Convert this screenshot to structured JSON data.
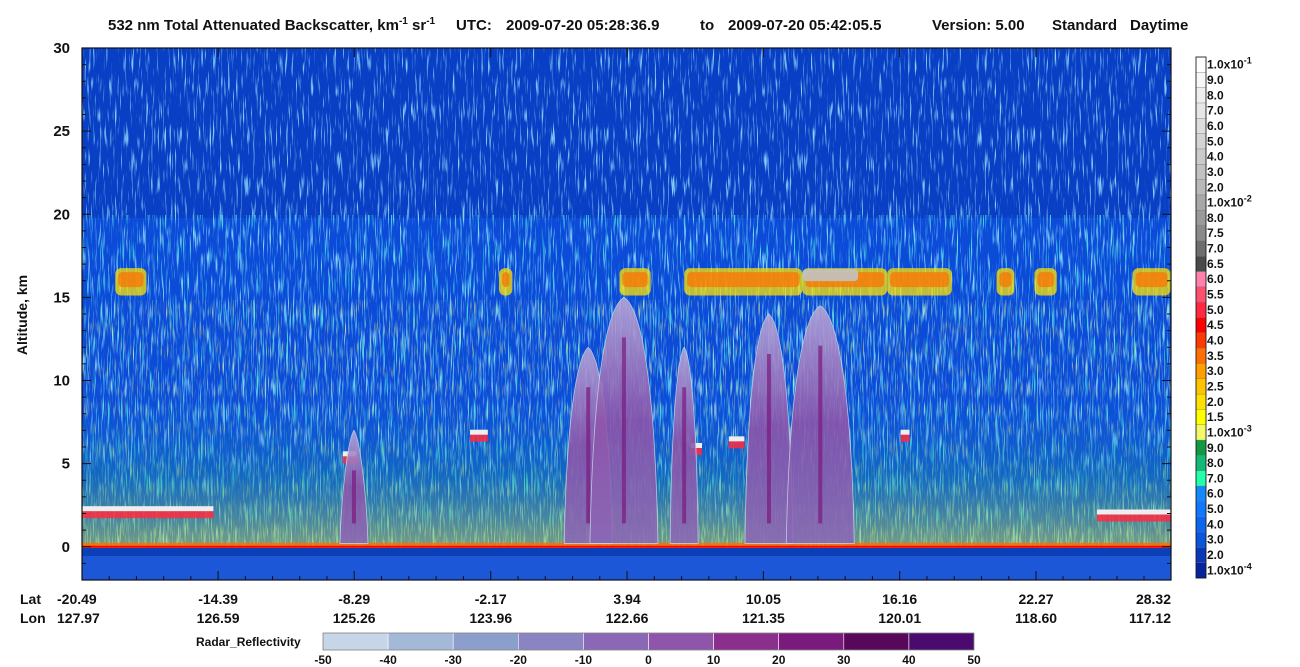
{
  "chart_data": {
    "type": "heatmap",
    "title": "532 nm Total Attenuated Backscatter, km",
    "title_unit_sup1": "-1",
    "title_unit_mid": " sr",
    "title_unit_sup2": "-1",
    "utc_label": "UTC:",
    "utc_start": "2009-07-20 05:28:36.9",
    "utc_to": "to",
    "utc_end": "2009-07-20 05:42:05.5",
    "version_label": "Version: 5.00",
    "product": "Standard",
    "mode": "Daytime",
    "ylabel": "Altitude, km",
    "ylim": [
      -2,
      30
    ],
    "yticks": [
      "0",
      "5",
      "10",
      "15",
      "20",
      "25",
      "30"
    ],
    "lat_label": "Lat",
    "lon_label": "Lon",
    "lat_ticks": [
      "-20.49",
      "-14.39",
      "-8.29",
      "-2.17",
      "3.94",
      "10.05",
      "16.16",
      "22.27",
      "28.32"
    ],
    "lon_ticks": [
      "127.97",
      "126.59",
      "125.26",
      "123.96",
      "122.66",
      "121.35",
      "120.01",
      "118.60",
      "117.12"
    ],
    "colorbar": {
      "labels": [
        {
          "b": "1.0x10",
          "e": "-1"
        },
        {
          "b": "9.0"
        },
        {
          "b": "8.0"
        },
        {
          "b": "7.0"
        },
        {
          "b": "6.0"
        },
        {
          "b": "5.0"
        },
        {
          "b": "4.0"
        },
        {
          "b": "3.0"
        },
        {
          "b": "2.0"
        },
        {
          "b": "1.0x10",
          "e": "-2"
        },
        {
          "b": "8.0"
        },
        {
          "b": "7.5"
        },
        {
          "b": "7.0"
        },
        {
          "b": "6.5"
        },
        {
          "b": "6.0"
        },
        {
          "b": "5.5"
        },
        {
          "b": "5.0"
        },
        {
          "b": "4.5"
        },
        {
          "b": "4.0"
        },
        {
          "b": "3.5"
        },
        {
          "b": "3.0"
        },
        {
          "b": "2.5"
        },
        {
          "b": "2.0"
        },
        {
          "b": "1.5"
        },
        {
          "b": "1.0x10",
          "e": "-3"
        },
        {
          "b": "9.0"
        },
        {
          "b": "8.0"
        },
        {
          "b": "7.0"
        },
        {
          "b": "6.0"
        },
        {
          "b": "5.0"
        },
        {
          "b": "4.0"
        },
        {
          "b": "3.0"
        },
        {
          "b": "2.0"
        },
        {
          "b": "1.0x10",
          "e": "-4"
        }
      ],
      "colors": [
        "#ffffff",
        "#f7f7f7",
        "#eeeeee",
        "#e6e6e6",
        "#dddddd",
        "#d4d4d4",
        "#cbcbcb",
        "#c2c2c2",
        "#b9b9b9",
        "#a8a8a8",
        "#9a9a9a",
        "#8a8a8a",
        "#6e6e6e",
        "#4a4a4a",
        "#ff7faf",
        "#ff4f70",
        "#ff2a40",
        "#ff0000",
        "#ff3a00",
        "#ff6e00",
        "#ffa000",
        "#ffc400",
        "#ffe000",
        "#ffff00",
        "#f3f866",
        "#119944",
        "#11bb77",
        "#22ffaa",
        "#1288ff",
        "#0f78ff",
        "#0b66f0",
        "#0a55e0",
        "#0838b8",
        "#06229e"
      ]
    },
    "radar": {
      "label": "Radar_Reflectivity",
      "ticks": [
        "-50",
        "-40",
        "-30",
        "-20",
        "-10",
        "0",
        "10",
        "20",
        "30",
        "40",
        "50"
      ],
      "colors": [
        "#c6d6e6",
        "#a4b9d8",
        "#8c9ecc",
        "#8a84c2",
        "#8a68b6",
        "#8f55aa",
        "#8a2f8c",
        "#7a1a7c",
        "#57085a",
        "#4b0a6e",
        "#3f0a90"
      ]
    },
    "features": {
      "cirrus_layer_km": [
        14,
        17
      ],
      "surface_km": 0,
      "convective_towers": [
        {
          "lat": -8.3,
          "top_km": 7
        },
        {
          "lat": 2.2,
          "top_km": 12
        },
        {
          "lat": 3.8,
          "top_km": 15
        },
        {
          "lat": 6.5,
          "top_km": 12
        },
        {
          "lat": 10.3,
          "top_km": 14
        },
        {
          "lat": 12.6,
          "top_km": 14.5
        }
      ]
    }
  }
}
